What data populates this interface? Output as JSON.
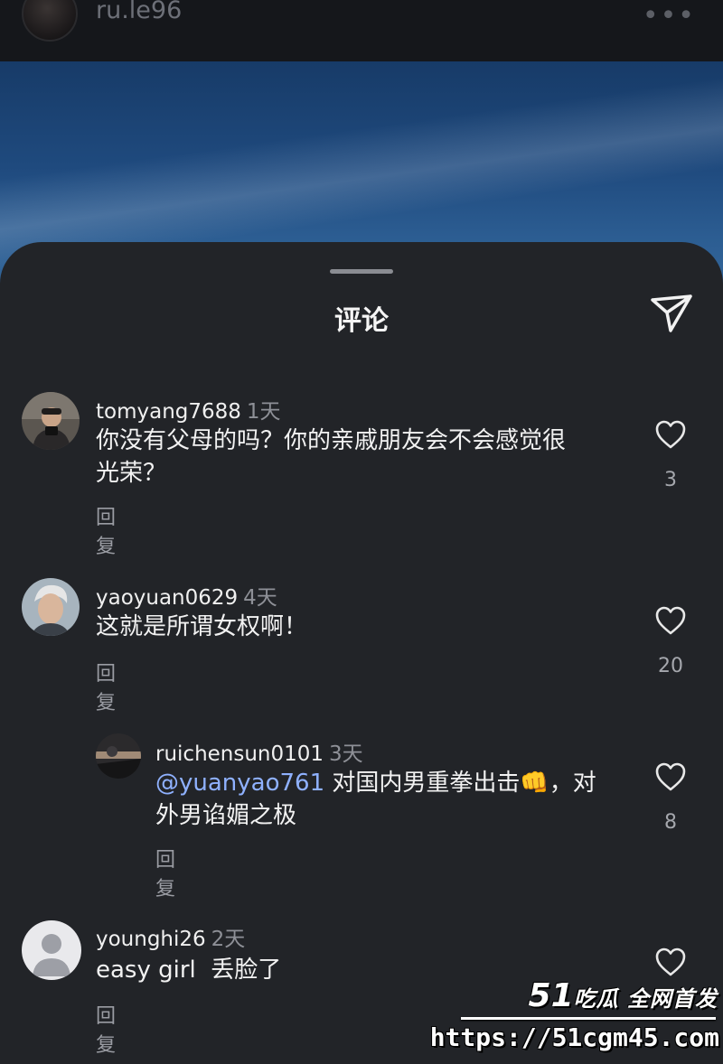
{
  "header": {
    "username": "ru.le96",
    "more": "•••"
  },
  "sheet": {
    "title": "评论"
  },
  "comments": [
    {
      "username": "tomyang7688",
      "time": "1天",
      "text_line1": "你没有父母的吗？你的亲戚朋友会不会感觉很",
      "text_line2": "光荣？",
      "reply": "回复",
      "likes": "3"
    },
    {
      "username": "yaoyuan0629",
      "time": "4天",
      "text_line1": "这就是所谓女权啊！",
      "reply": "回复",
      "likes": "20"
    },
    {
      "username": "ruichensun0101",
      "time": "3天",
      "mention": "@yuanyao761",
      "text_line1": " 对国内男重拳出击👊，对",
      "text_line2": "外男谄媚之极",
      "reply": "回复",
      "likes": "8"
    },
    {
      "username": "younghi26",
      "time": "2天",
      "text_line1": "easy girl  丢脸了",
      "reply": "回复",
      "likes": ""
    }
  ],
  "watermark": {
    "logo_num": "51",
    "logo_text": "吃瓜 全网首发",
    "url": "https://51cgm45.com"
  },
  "colors": {
    "sheet_bg": "#222428",
    "mention": "#8fb1ff",
    "muted": "#9a9ca3"
  }
}
